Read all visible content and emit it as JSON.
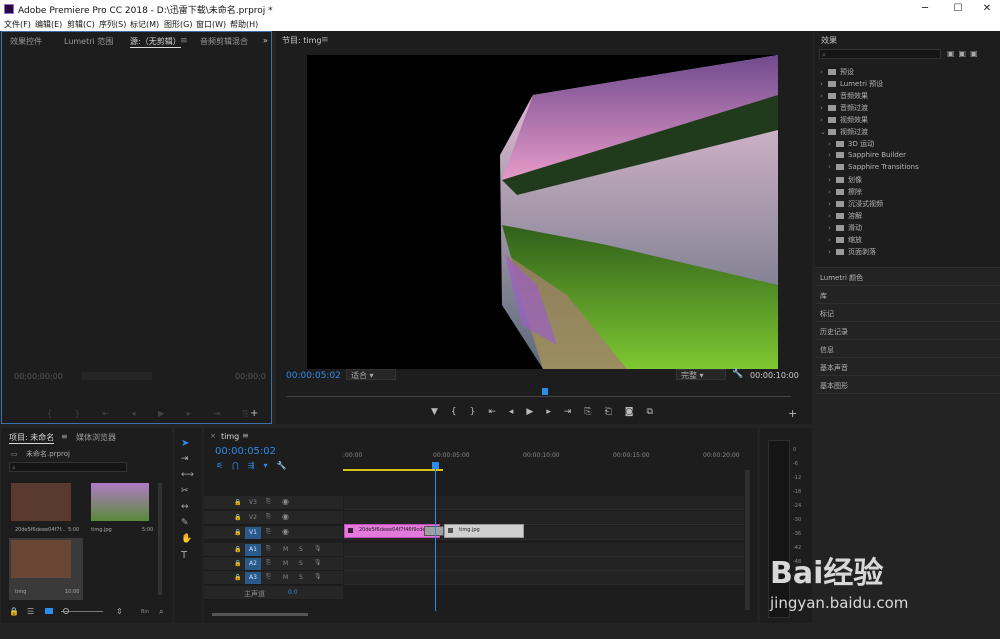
{
  "window": {
    "title": "Adobe Premiere Pro CC 2018 - D:\\迅雷下载\\未命名.prproj *",
    "minimize": "─",
    "maximize": "☐",
    "close": "✕"
  },
  "menu": [
    "文件(F)",
    "编辑(E)",
    "剪辑(C)",
    "序列(S)",
    "标记(M)",
    "图形(G)",
    "窗口(W)",
    "帮助(H)"
  ],
  "source_panel": {
    "tabs": [
      "效果控件",
      "Lumetri 范围",
      "源:（无剪辑）",
      "音频剪辑混合"
    ],
    "tc_left": "00;00;00;00",
    "tc_right": "00;00;0",
    "more": "»"
  },
  "program": {
    "title": "节目: timg",
    "timecode": "00:00:05:02",
    "fit": "适合",
    "quality": "完整",
    "duration": "00:00:10:00"
  },
  "project": {
    "tabs": [
      "项目: 未命名",
      "媒体浏览器"
    ],
    "file": "未命名.prproj",
    "items": [
      {
        "name": "20de5f6deee04f7f...",
        "dur": "5:00"
      },
      {
        "name": "timg.jpg",
        "dur": "5:00"
      },
      {
        "name": "timg",
        "dur": "10:00"
      }
    ]
  },
  "timeline": {
    "tab": "timg",
    "timecode": "00:00:05:02",
    "ruler": [
      ":00:00",
      "00:00:05:00",
      "00:00:10:00",
      "00:00:15:00",
      "00:00:20:00"
    ],
    "video_tracks": [
      "V3",
      "V2",
      "V1"
    ],
    "audio_tracks": [
      "A1",
      "A2",
      "A3"
    ],
    "master": "主声道",
    "master_val": "0.0",
    "clip1": "20de5f6deee04f7f46f9cde5...",
    "clip2": "timg.jpg",
    "ms": [
      "M",
      "S"
    ]
  },
  "meter": {
    "ticks": [
      "0",
      "-6",
      "-12",
      "-18",
      "-24",
      "-30",
      "-36",
      "-42",
      "-48",
      "-54"
    ]
  },
  "effects": {
    "title": "效果",
    "items": [
      {
        "label": "预设",
        "depth": 0,
        "open": false
      },
      {
        "label": "Lumetri 预设",
        "depth": 0,
        "open": false
      },
      {
        "label": "音频效果",
        "depth": 0,
        "open": false
      },
      {
        "label": "音频过渡",
        "depth": 0,
        "open": false
      },
      {
        "label": "视频效果",
        "depth": 0,
        "open": false
      },
      {
        "label": "视频过渡",
        "depth": 0,
        "open": true
      },
      {
        "label": "3D 运动",
        "depth": 1
      },
      {
        "label": "Sapphire Builder",
        "depth": 1
      },
      {
        "label": "Sapphire Transitions",
        "depth": 1
      },
      {
        "label": "划像",
        "depth": 1
      },
      {
        "label": "擦除",
        "depth": 1
      },
      {
        "label": "沉浸式视频",
        "depth": 1
      },
      {
        "label": "溶解",
        "depth": 1
      },
      {
        "label": "滑动",
        "depth": 1
      },
      {
        "label": "缩放",
        "depth": 1
      },
      {
        "label": "页面剥落",
        "depth": 1
      }
    ],
    "panels": [
      "Lumetri 颜色",
      "库",
      "标记",
      "历史记录",
      "信息",
      "基本声音",
      "基本图形"
    ]
  },
  "watermark": {
    "logo": "Bai经验",
    "url": "jingyan.baidu.com"
  }
}
